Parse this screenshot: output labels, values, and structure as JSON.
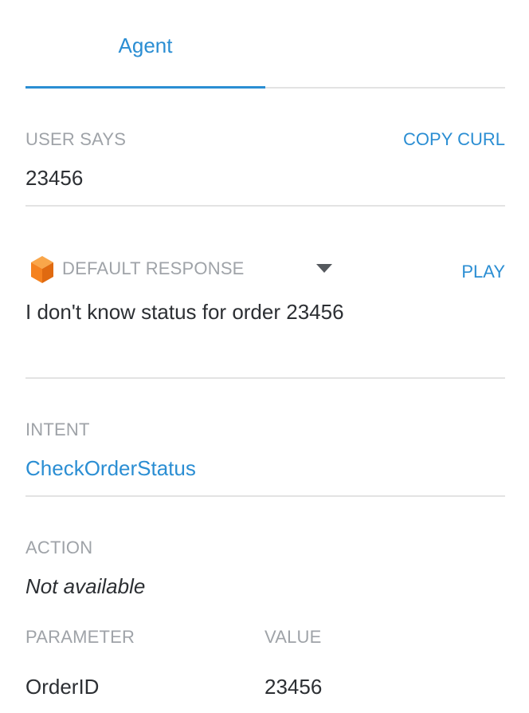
{
  "tabs": {
    "agent_label": "Agent"
  },
  "user_says": {
    "label": "USER SAYS",
    "copy_curl_label": "COPY CURL",
    "value": "23456"
  },
  "response": {
    "icon": "orange-cube-icon",
    "label": "DEFAULT RESPONSE",
    "play_label": "PLAY",
    "text": "I don't know status for order 23456"
  },
  "intent": {
    "label": "INTENT",
    "value": "CheckOrderStatus"
  },
  "action": {
    "label": "ACTION",
    "value": "Not available"
  },
  "parameters": {
    "headers": {
      "parameter": "PARAMETER",
      "value": "VALUE"
    },
    "rows": [
      {
        "name": "OrderID",
        "value": "23456"
      }
    ]
  },
  "colors": {
    "accent": "#2b8ed3",
    "muted_label": "#9fa3a8",
    "text": "#2c2f33",
    "divider": "#e3e3e3",
    "cube_orange": "#f5821f"
  }
}
